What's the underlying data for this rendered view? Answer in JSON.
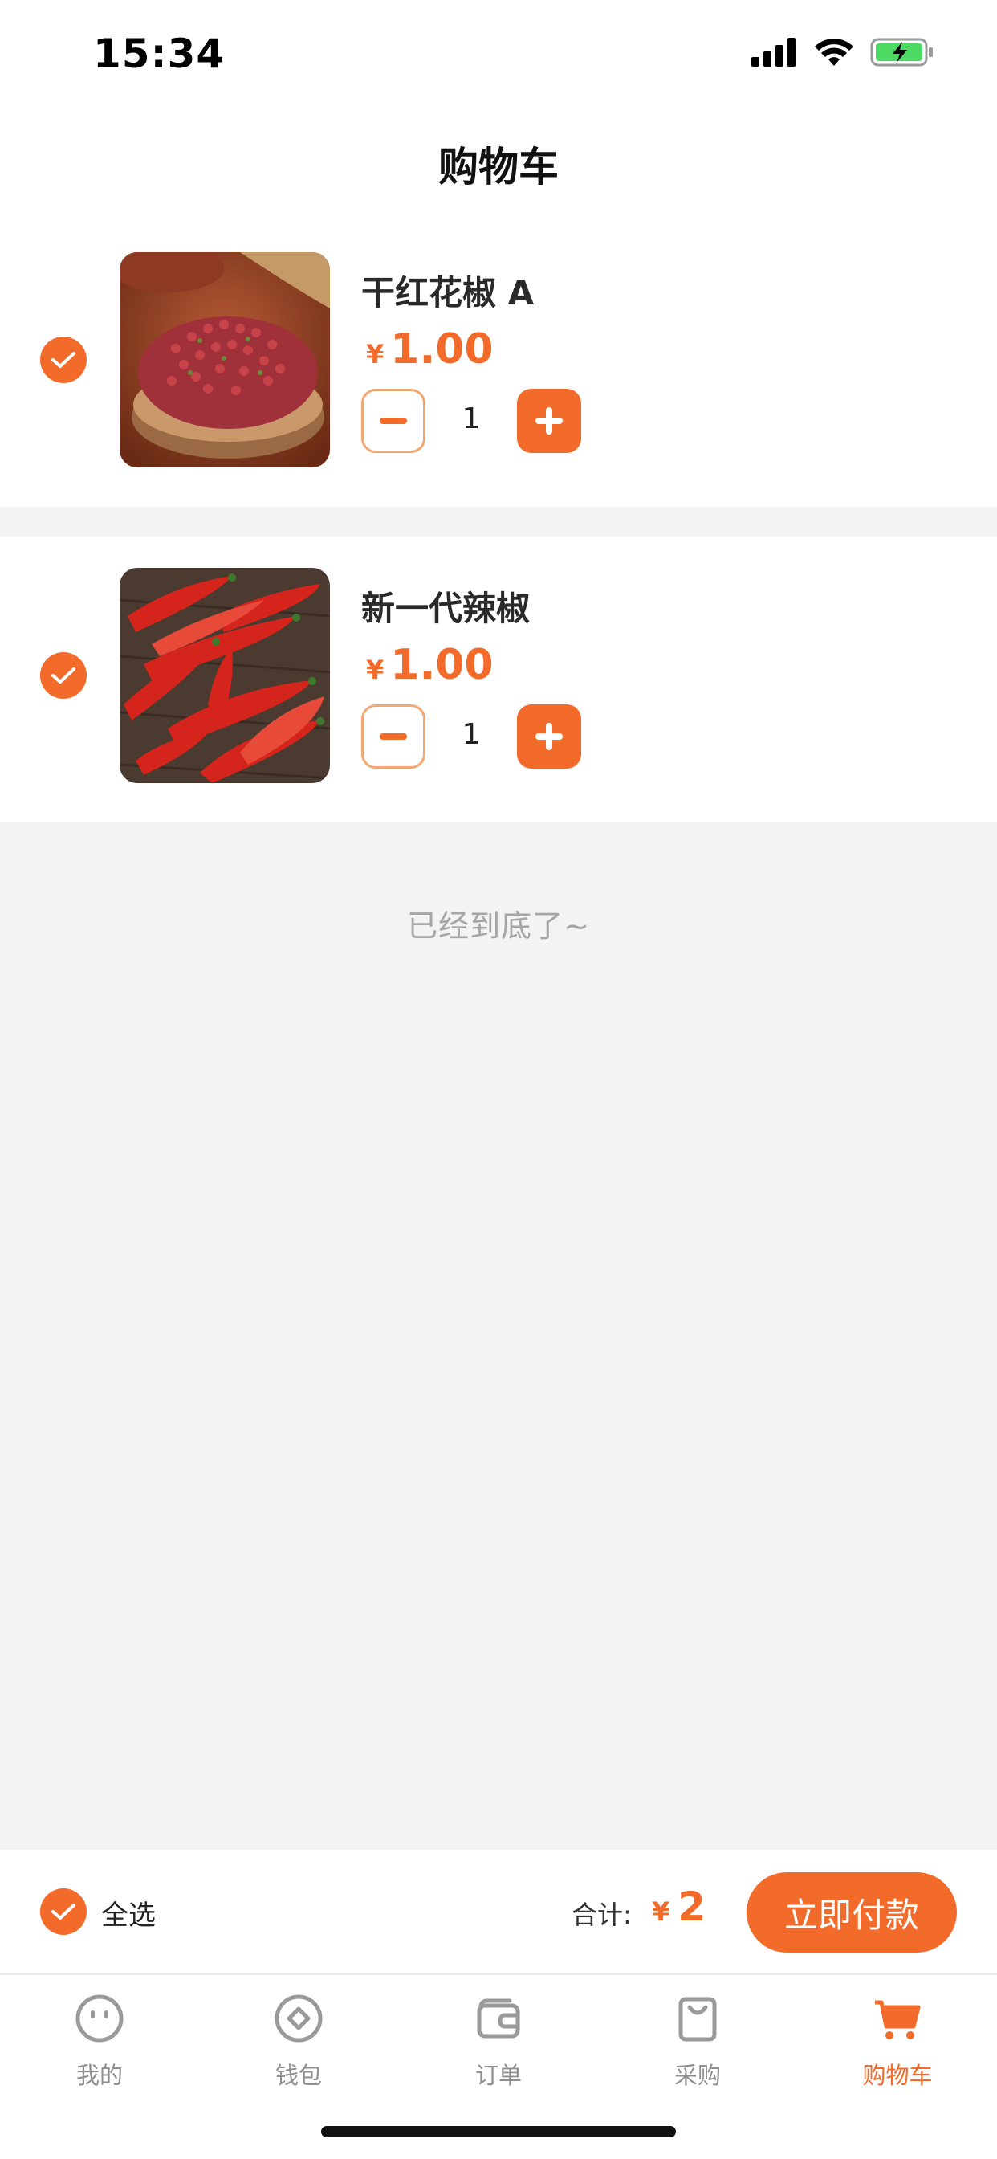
{
  "status_bar": {
    "time": "15:34"
  },
  "header": {
    "title": "购物车"
  },
  "cart": {
    "items": [
      {
        "name": "干红花椒 A",
        "currency": "¥",
        "price": "1.00",
        "quantity": "1",
        "selected": true,
        "image": "dried-red-sichuan-pepper"
      },
      {
        "name": "新一代辣椒",
        "currency": "¥",
        "price": "1.00",
        "quantity": "1",
        "selected": true,
        "image": "red-chili-peppers"
      }
    ],
    "end_text": "已经到底了~"
  },
  "checkout": {
    "select_all_label": "全选",
    "total_label": "合计:",
    "currency": "¥",
    "total": "2",
    "pay_label": "立即付款"
  },
  "tabs": [
    {
      "label": "我的",
      "icon": "smiley-face-icon"
    },
    {
      "label": "钱包",
      "icon": "coin-icon"
    },
    {
      "label": "订单",
      "icon": "wallet-icon"
    },
    {
      "label": "采购",
      "icon": "shopping-bag-icon"
    },
    {
      "label": "购物车",
      "icon": "cart-icon",
      "active": true
    }
  ],
  "colors": {
    "accent": "#f26b2a",
    "accent_light": "#f2a873",
    "background": "#f3f3f3",
    "muted_text": "#a5a5a5"
  }
}
